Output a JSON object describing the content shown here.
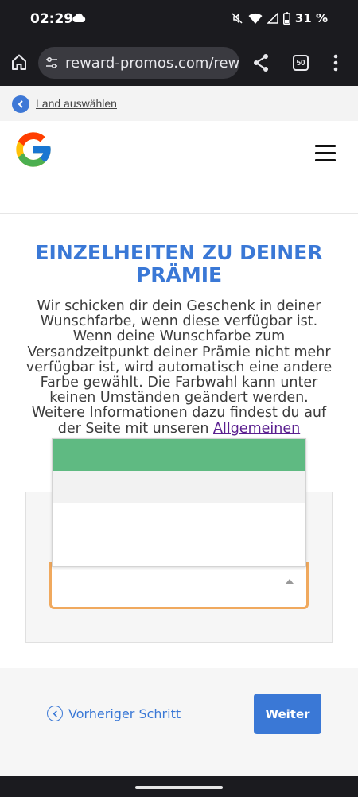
{
  "status_bar": {
    "time": "02:29",
    "battery_percent": "31 %",
    "icons": [
      "cloud-icon",
      "mute-icon",
      "wifi-icon",
      "signal-icon",
      "battery-icon"
    ]
  },
  "browser": {
    "url": "reward-promos.com/reward",
    "tab_count": "50",
    "icons": [
      "home-icon",
      "tune-icon",
      "share-icon",
      "tabs-icon",
      "more-vert-icon"
    ]
  },
  "land_select": {
    "label": "Land auswählen"
  },
  "header": {
    "logo": "google-logo-icon",
    "menu": "hamburger-icon"
  },
  "main": {
    "title": "EINZELHEITEN ZU DEINER PRÄMIE",
    "description": "Wir schicken dir dein Geschenk in deiner Wunschfarbe, wenn diese verfügbar ist. Wenn deine Wunschfarbe zum Versandzeitpunkt deiner Prämie nicht mehr verfügbar ist, wird automatisch eine andere Farbe gewählt. Die Farbwahl kann unter keinen Umständen geändert werden. Weitere Informationen dazu findest du auf der Seite mit unseren",
    "link_text": "Allgemeinen"
  },
  "colors": {
    "accent": "#3a78d6",
    "select_border": "#f0a95e",
    "option_highlight": "#5fba82",
    "link_visited": "#5a1f8f"
  },
  "footer": {
    "prev_label": "Vorheriger Schritt",
    "next_label": "Weiter"
  }
}
